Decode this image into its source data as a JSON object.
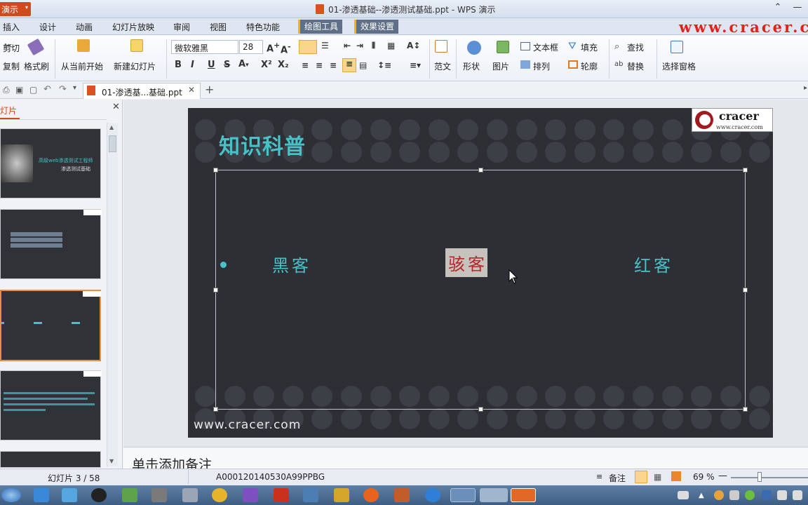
{
  "titlebar": {
    "app_menu": "演示",
    "title": "01-渗透基础--渗透测试基础.ppt - WPS 演示"
  },
  "menu": {
    "tabs": [
      "插入",
      "设计",
      "动画",
      "幻灯片放映",
      "审阅",
      "视图",
      "特色功能"
    ],
    "context_tabs": [
      "绘图工具",
      "效果设置"
    ],
    "watermark": "www.cracer.c"
  },
  "ribbon": {
    "cut": "剪切",
    "copy": "复制",
    "format_painter": "格式刷",
    "from_current": "从当前开始",
    "new_slide": "新建幻灯片",
    "font_name": "微软雅黑",
    "font_size": "28",
    "bold": "B",
    "italic": "I",
    "underline": "U",
    "strike": "S",
    "superscript": "X²",
    "subscript": "X₂",
    "template": "范文",
    "shapes": "形状",
    "picture": "图片",
    "textbox": "文本框",
    "arrange": "排列",
    "fill": "填充",
    "outline": "轮廓",
    "find": "查找",
    "replace": "替换",
    "selection_pane": "选择窗格"
  },
  "doc_tab": "01-渗透基...基础.ppt",
  "left_panel": {
    "label": "灯片",
    "thumb1_title": "高级web渗透测试工程师",
    "thumb1_subtitle": "渗透测试基础"
  },
  "slide": {
    "title": "知识科普",
    "words": [
      "黑客",
      "骇客",
      "红客"
    ],
    "logo_name": "cracer",
    "logo_url": "www.cracer.com",
    "footer_url": "www.cracer.com",
    "colors": {
      "accent": "#46c2c8",
      "highlight_text": "#b8262b",
      "highlight_bg": "#c6c2bd",
      "background": "#2d2f34"
    }
  },
  "notes": {
    "placeholder": "单击添加备注"
  },
  "status": {
    "slide_counter": "幻灯片 3 / 58",
    "doc_id": "A000120140530A99PPBG",
    "notes_label": "备注",
    "zoom": "69 %"
  }
}
